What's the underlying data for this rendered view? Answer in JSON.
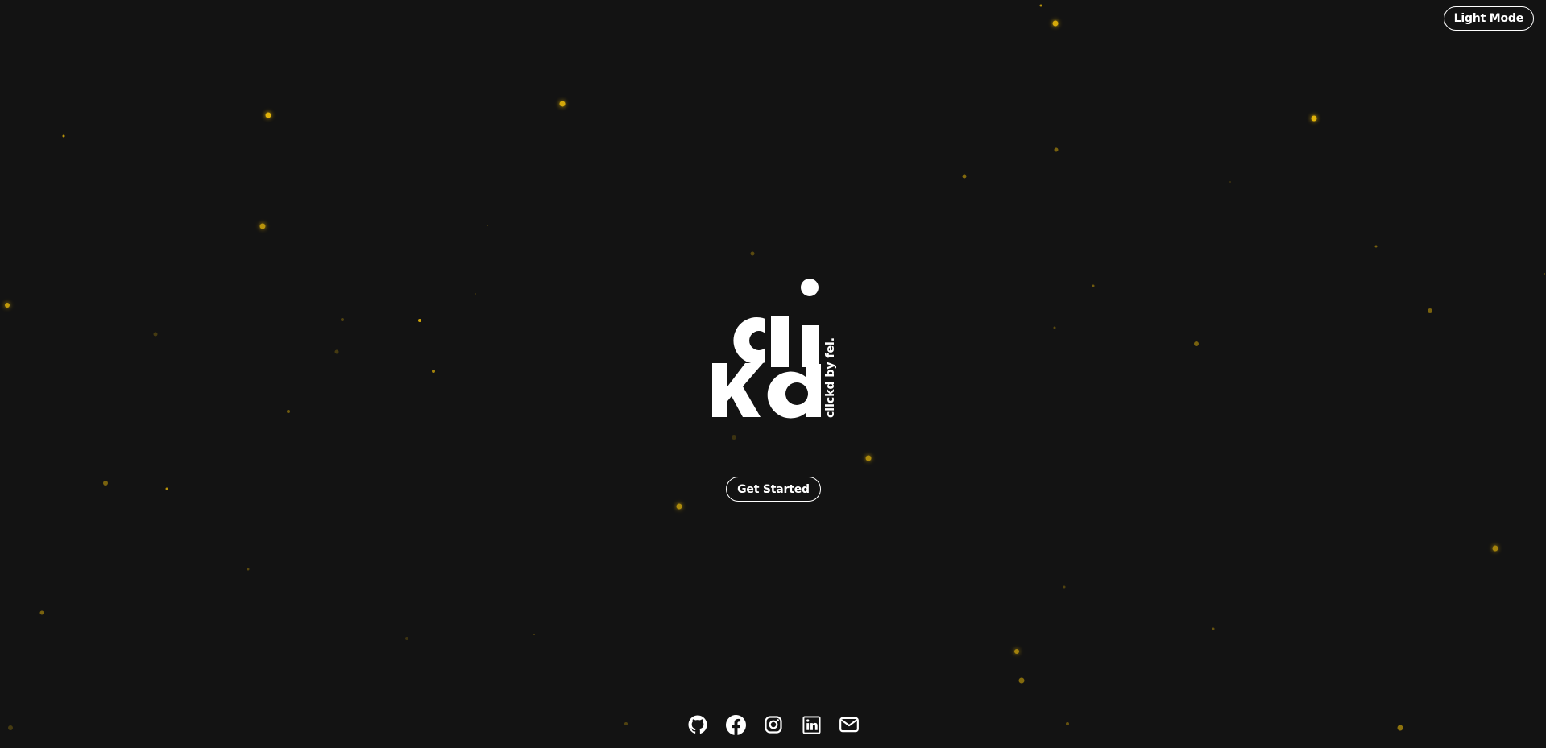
{
  "header": {
    "theme_toggle_label": "Light Mode"
  },
  "hero": {
    "logo": {
      "letters": [
        "c",
        "l",
        "i",
        "k",
        "d"
      ],
      "side_text": "clickd by fei."
    },
    "cta_label": "Get Started"
  },
  "footer": {
    "social_links": [
      {
        "icon": "github-icon"
      },
      {
        "icon": "facebook-icon"
      },
      {
        "icon": "instagram-icon"
      },
      {
        "icon": "linkedin-icon"
      },
      {
        "icon": "mail-icon"
      }
    ]
  },
  "theme": {
    "background": "#131313",
    "foreground": "#ffffff",
    "particle_color": "#e0b20a"
  }
}
